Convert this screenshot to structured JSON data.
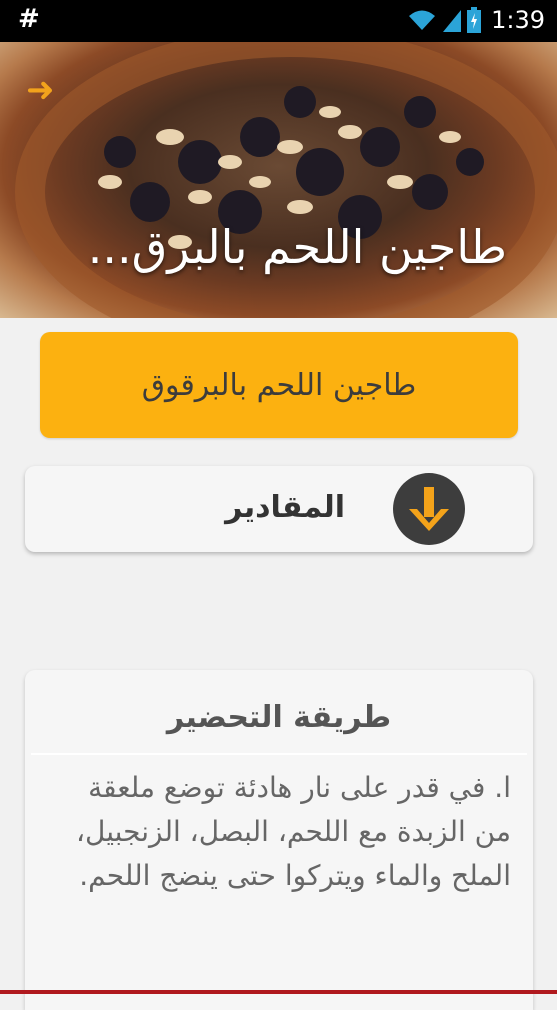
{
  "status_bar": {
    "notification": "#",
    "time": "1:39"
  },
  "header": {
    "title": "طاجين اللحم بالبرق...",
    "back_icon": "arrow-right-icon",
    "accent": "#f2a31c"
  },
  "title_card": {
    "label": "طاجين اللحم بالبرقوق",
    "color": "#fcb110"
  },
  "ingredients": {
    "label": "المقادير",
    "icon": "download-arrow-icon"
  },
  "method": {
    "title": "طريقة التحضير",
    "text": "ا. في قدر على نار هادئة توضع ملعقة من الزبدة مع اللحم، البصل، الزنجبيل، الملح والماء ويتركوا حتى ينضج اللحم."
  }
}
